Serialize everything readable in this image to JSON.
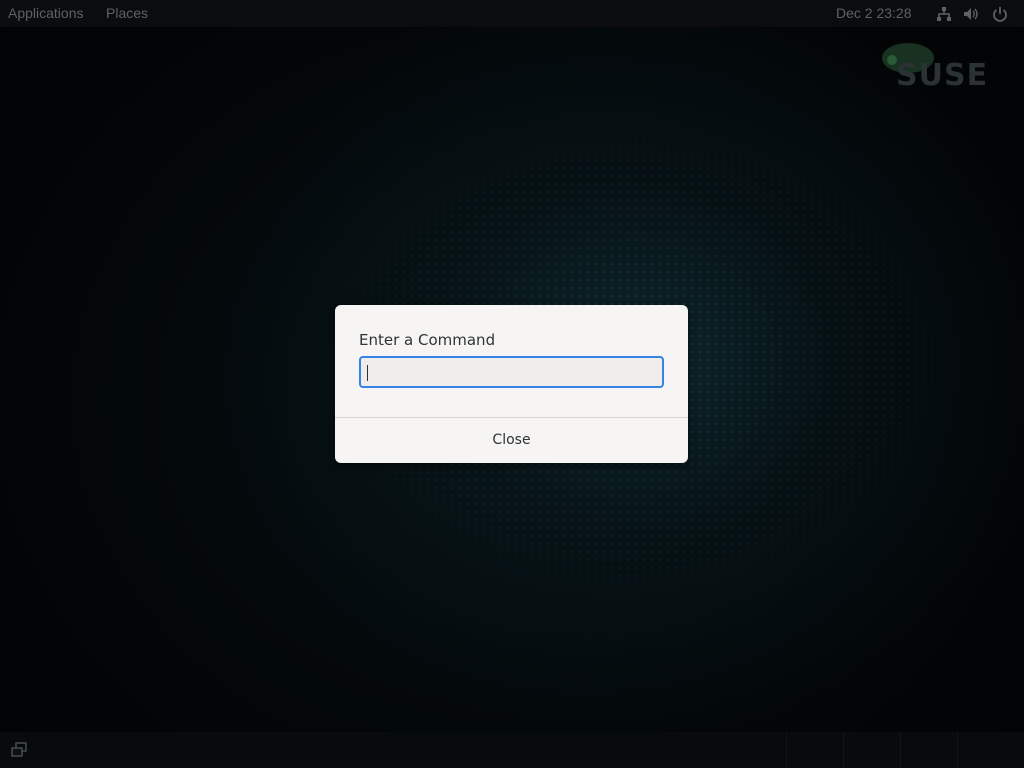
{
  "topbar": {
    "applications_label": "Applications",
    "places_label": "Places",
    "clock": "Dec 2  23:28",
    "icons": [
      "network-icon",
      "volume-icon",
      "power-icon"
    ]
  },
  "logo": {
    "text": "SUSE"
  },
  "dialog": {
    "title": "Enter a Command",
    "input_value": "",
    "close_label": "Close",
    "accent_color": "#3584e4"
  },
  "bottombar": {
    "icons": [
      "show-desktop-icon"
    ],
    "workspace_count": 4
  }
}
